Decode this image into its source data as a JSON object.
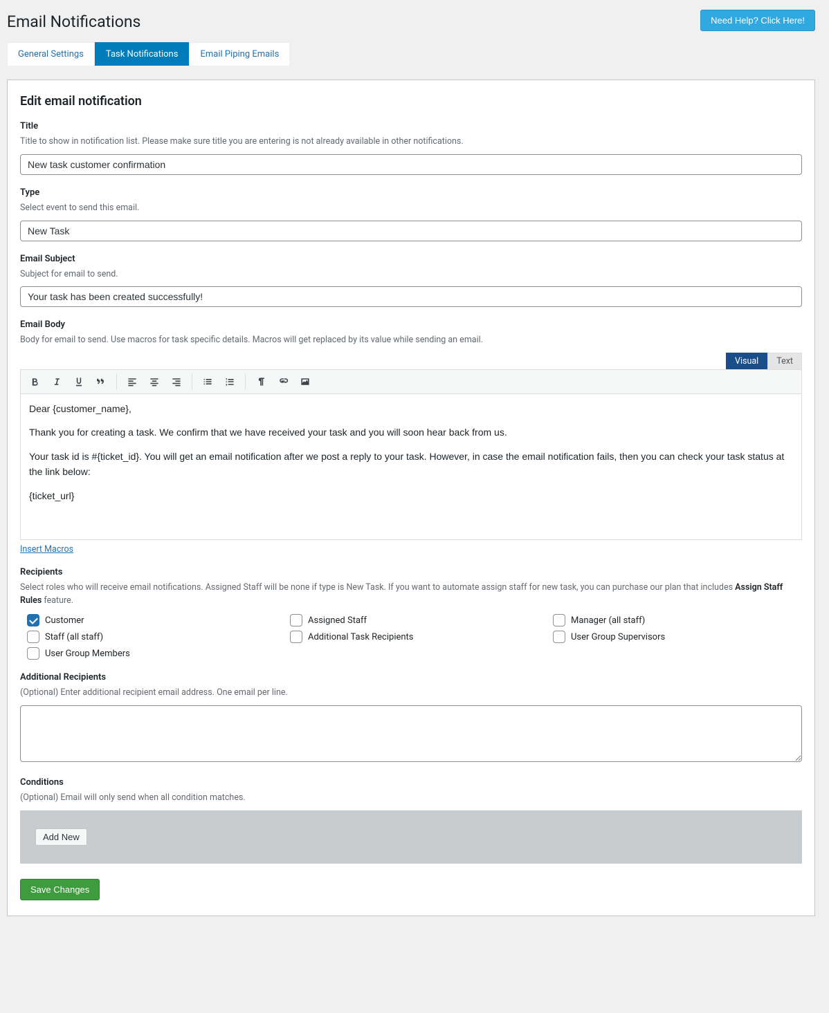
{
  "header": {
    "page_title": "Email Notifications",
    "help_button": "Need Help? Click Here!"
  },
  "tabs": [
    {
      "label": "General Settings",
      "active": false
    },
    {
      "label": "Task Notifications",
      "active": true
    },
    {
      "label": "Email Piping Emails",
      "active": false
    }
  ],
  "section_title": "Edit email notification",
  "fields": {
    "title": {
      "label": "Title",
      "hint": "Title to show in notification list. Please make sure title you are entering is not already available in other notifications.",
      "value": "New task customer confirmation"
    },
    "type": {
      "label": "Type",
      "hint": "Select event to send this email.",
      "value": "New Task"
    },
    "subject": {
      "label": "Email Subject",
      "hint": "Subject for email to send.",
      "value": "Your task has been created successfully!"
    },
    "body": {
      "label": "Email Body",
      "hint": "Body for email to send. Use macros for task specific details. Macros will get replaced by its value while sending an email."
    }
  },
  "editor_tabs": {
    "visual": "Visual",
    "text": "Text"
  },
  "editor_content": {
    "p1": "Dear {customer_name},",
    "p2": "Thank you for creating a task. We confirm that we have received your task and you will soon hear back from us.",
    "p3": "Your task id is #{ticket_id}. You will get an email notification after we post a reply to your task. However, in case the email notification fails, then you can check your task status at the link below:",
    "p4": "{ticket_url}"
  },
  "insert_macros": "Insert Macros",
  "recipients": {
    "label": "Recipients",
    "hint_prefix": "Select roles who will receive email notifications. Assigned Staff will be none if type is New Task. If you want to automate assign staff for new task, you can purchase our plan that includes ",
    "hint_bold": "Assign Staff Rules",
    "hint_suffix": " feature.",
    "items": [
      {
        "label": "Customer",
        "checked": true
      },
      {
        "label": "Assigned Staff",
        "checked": false
      },
      {
        "label": "Manager (all staff)",
        "checked": false
      },
      {
        "label": "Staff (all staff)",
        "checked": false
      },
      {
        "label": "Additional Task Recipients",
        "checked": false
      },
      {
        "label": "User Group Supervisors",
        "checked": false
      },
      {
        "label": "User Group Members",
        "checked": false
      }
    ]
  },
  "additional": {
    "label": "Additional Recipients",
    "hint": "(Optional) Enter additional recipient email address. One email per line.",
    "value": ""
  },
  "conditions": {
    "label": "Conditions",
    "hint": "(Optional) Email will only send when all condition matches.",
    "add_new": "Add New"
  },
  "save_button": "Save Changes"
}
